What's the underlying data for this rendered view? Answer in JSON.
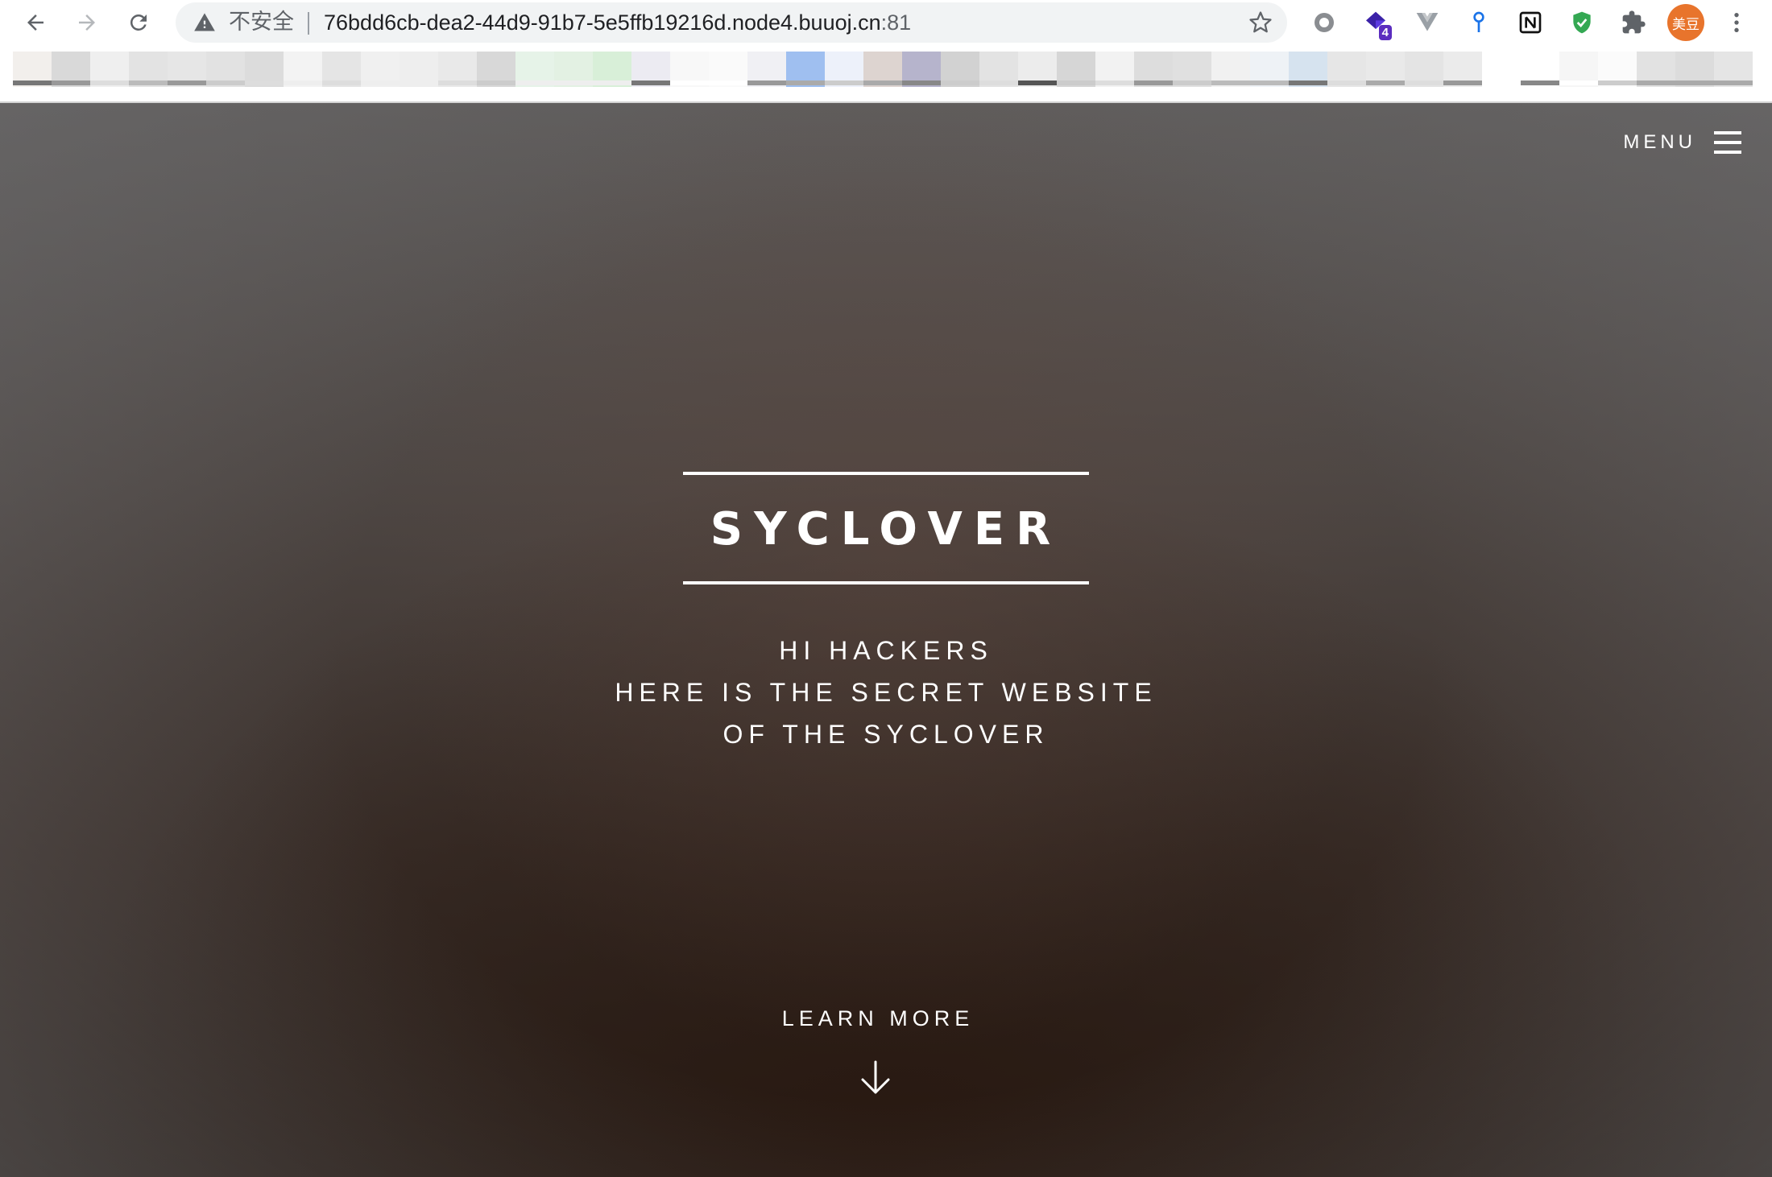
{
  "browser": {
    "security_label": "不安全",
    "url_host": "76bdd6cb-dea2-44d9-91b7-5e5ffb19216d.node4.buuoj.cn",
    "url_port": ":81",
    "extensions": [
      {
        "name": "circle-extension-icon"
      },
      {
        "name": "purple-extension-icon",
        "badge": "4"
      },
      {
        "name": "vue-devtools-icon"
      },
      {
        "name": "pin-extension-icon"
      },
      {
        "name": "notion-icon"
      },
      {
        "name": "shield-check-icon"
      },
      {
        "name": "puzzle-icon"
      }
    ],
    "profile_label": "美豆",
    "colors": {
      "accent_badge": "#5b2dbf",
      "profile": "#e8742c",
      "shield": "#34a853",
      "pin": "#1a73e8"
    }
  },
  "page": {
    "menu_label": "MENU",
    "title": "SYCLOVER",
    "tagline": [
      "HI HACKERS",
      "HERE IS THE SECRET WEBSITE",
      "OF THE SYCLOVER"
    ],
    "learn_more": "LEARN MORE"
  }
}
